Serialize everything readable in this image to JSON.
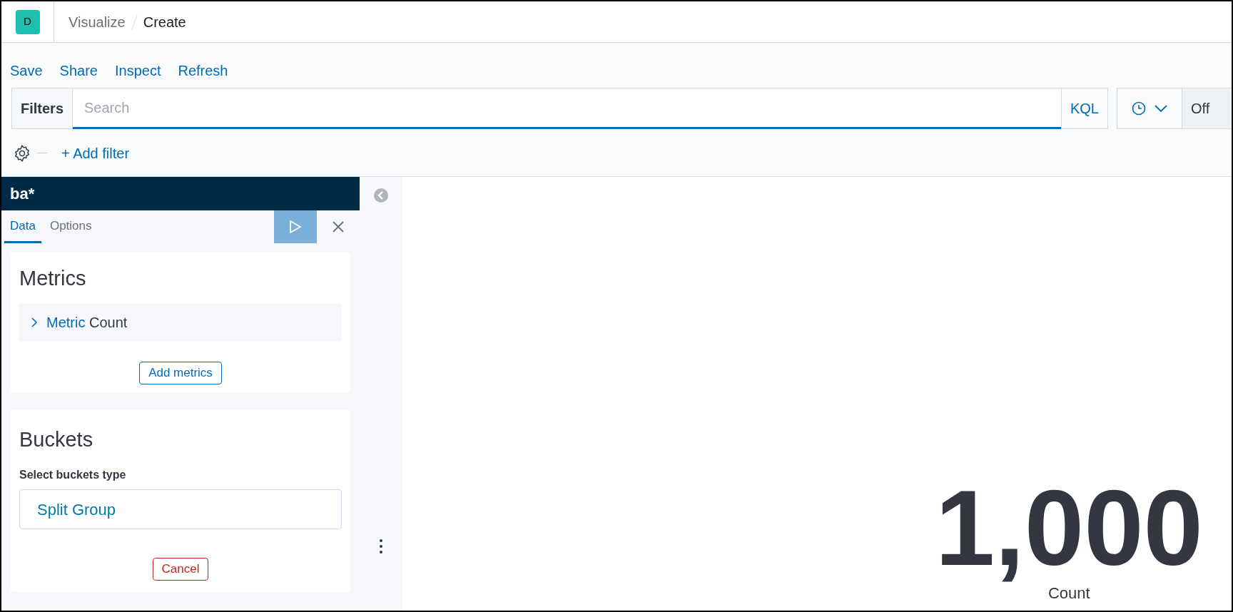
{
  "header": {
    "logo_letter": "D",
    "breadcrumbs": [
      {
        "label": "Visualize",
        "current": false
      },
      {
        "label": "Create",
        "current": true
      }
    ]
  },
  "top_menu": [
    "Save",
    "Share",
    "Inspect",
    "Refresh"
  ],
  "query_bar": {
    "filters_label": "Filters",
    "search": {
      "placeholder": "Search"
    },
    "language": "KQL",
    "refresh": "Off"
  },
  "add_filter": "+ Add filter",
  "editor": {
    "index_pattern": "ba*",
    "tabs": [
      {
        "label": "Data",
        "selected": true
      },
      {
        "label": "Options",
        "selected": false
      }
    ],
    "metrics": {
      "title": "Metrics",
      "items": [
        {
          "label": "Metric",
          "value": "Count",
          "expanded": false
        }
      ],
      "add_button": "Add metrics"
    },
    "buckets": {
      "title": "Buckets",
      "select_label": "Select buckets type",
      "options": [
        "Split Group"
      ],
      "cancel_button": "Cancel"
    }
  },
  "visualization": {
    "value": "1,000",
    "label": "Count"
  }
}
